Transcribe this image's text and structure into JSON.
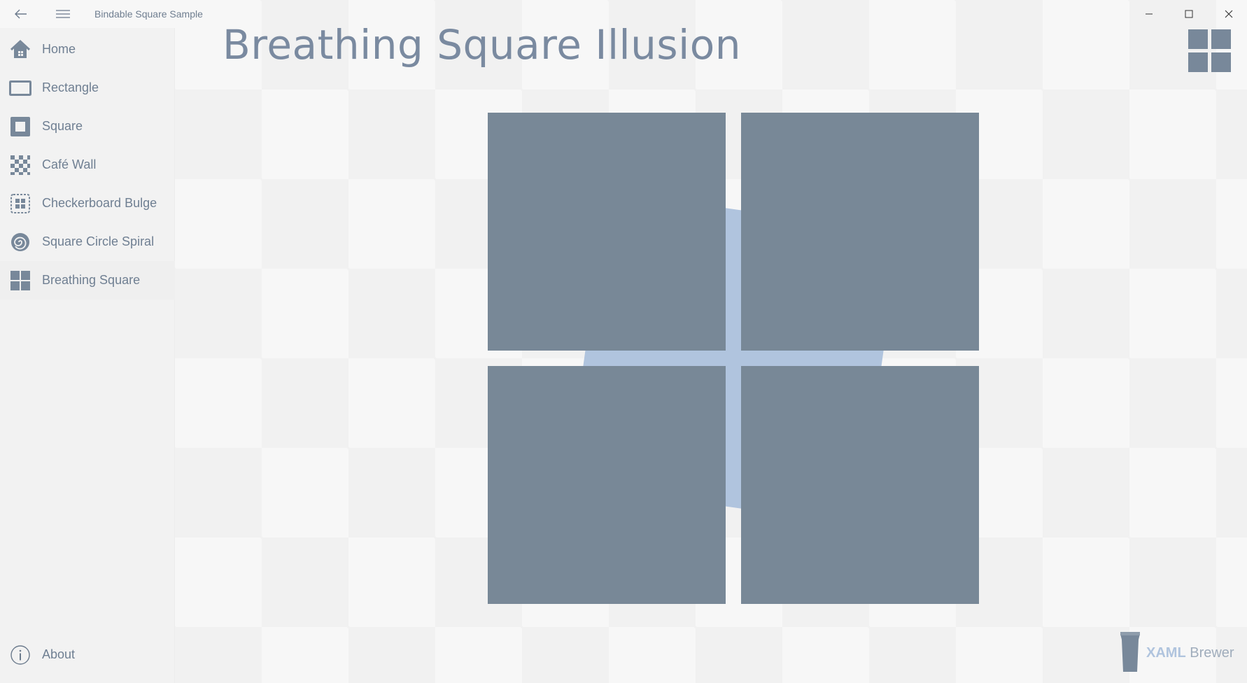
{
  "window": {
    "title": "Bindable Square Sample",
    "back_icon": "arrow-left-icon",
    "menu_icon": "hamburger-icon",
    "minimize_icon": "minimize-icon",
    "maximize_icon": "maximize-icon",
    "close_icon": "close-icon"
  },
  "sidebar": {
    "items": [
      {
        "label": "Home",
        "icon": "home-icon"
      },
      {
        "label": "Rectangle",
        "icon": "rectangle-icon"
      },
      {
        "label": "Square",
        "icon": "square-icon"
      },
      {
        "label": "Café Wall",
        "icon": "checker-icon"
      },
      {
        "label": "Checkerboard Bulge",
        "icon": "checkerboard-bulge-icon"
      },
      {
        "label": "Square Circle Spiral",
        "icon": "spiral-icon"
      },
      {
        "label": "Breathing Square",
        "icon": "four-squares-icon",
        "selected": true
      }
    ],
    "footer": {
      "label": "About",
      "icon": "info-icon"
    }
  },
  "page": {
    "title": "Breathing Square Illusion"
  },
  "brand": {
    "part1": "XAML",
    "part2": "Brewer"
  },
  "colors": {
    "accent": "#788897",
    "light_accent": "#b0c4de",
    "background": "#f7f7f7"
  }
}
